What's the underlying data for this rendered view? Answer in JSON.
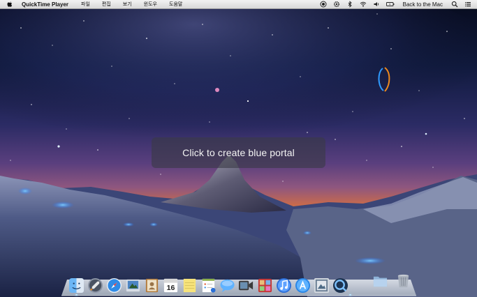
{
  "menubar": {
    "app_name": "QuickTime Player",
    "menus": [
      "파일",
      "편집",
      "보기",
      "윈도우",
      "도움말"
    ],
    "back_to_mac": "Back to the Mac",
    "status_icons": [
      "record-icon",
      "gear-icon",
      "bluetooth-icon",
      "wifi-icon",
      "volume-icon",
      "battery-icon"
    ],
    "right_icons": [
      "search-icon",
      "list-icon"
    ]
  },
  "overlay": {
    "button_label": "Click to create blue portal"
  },
  "dock": {
    "apps": [
      "finder-icon",
      "launchpad-icon",
      "safari-icon",
      "mail-icon",
      "contacts-icon",
      "calendar-icon",
      "notes-icon",
      "reminders-icon",
      "messages-icon",
      "facetime-icon",
      "photo-booth-icon",
      "itunes-icon",
      "app-store-icon",
      "preview-icon",
      "quicktime-icon"
    ],
    "calendar_day": "16",
    "right_items": [
      "downloads-folder-icon",
      "trash-icon"
    ]
  },
  "colors": {
    "portal_blue": "#2f9bff",
    "portal_orange": "#f08a1c",
    "menubar": "#e6e6e6"
  }
}
